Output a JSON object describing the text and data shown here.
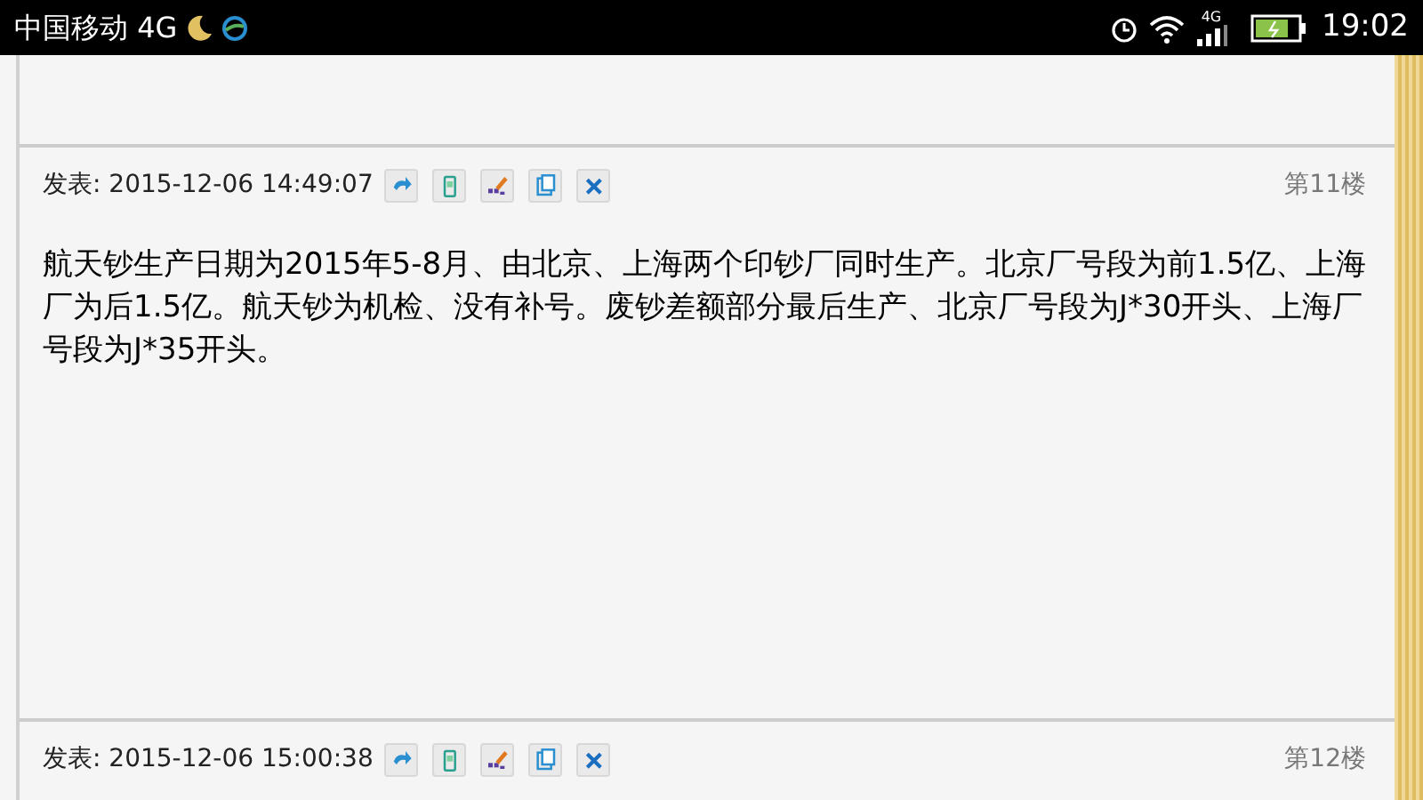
{
  "status_bar": {
    "carrier": "中国移动 4G",
    "network": "4G",
    "time": "19:02"
  },
  "posts": [
    {
      "posted": "发表: 2015-12-06 14:49:07",
      "floor": "第11楼",
      "body": "航天钞生产日期为2015年5-8月、由北京、上海两个印钞厂同时生产。北京厂号段为前1.5亿、上海厂为后1.5亿。航天钞为机检、没有补号。废钞差额部分最后生产、北京厂号段为J*30开头、上海厂号段为J*35开头。"
    },
    {
      "posted": "发表: 2015-12-06 15:00:38",
      "floor": "第12楼"
    }
  ]
}
